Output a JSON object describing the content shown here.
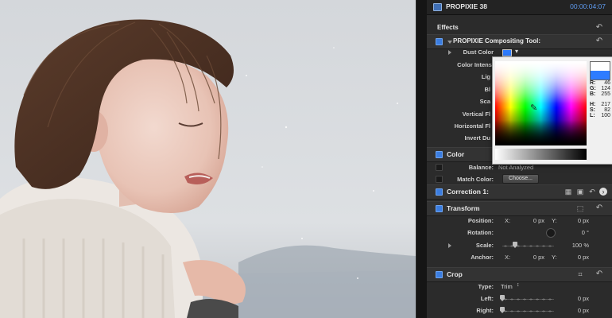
{
  "title": {
    "clip_name": "PROPIXIE 38",
    "timecode": "00:00:04:07"
  },
  "effects": {
    "label": "Effects",
    "tool_name": "PROPIXIE Compositing Tool:",
    "params": [
      {
        "label": "Dust Color"
      },
      {
        "label": "Color Intensi"
      },
      {
        "label": "Lig"
      },
      {
        "label": "Bl"
      },
      {
        "label": "Sca"
      },
      {
        "label": "Vertical Fl"
      },
      {
        "label": "Horizontal Fl"
      },
      {
        "label": "Invert Du"
      }
    ],
    "dust_color_hex": "#2e7cff"
  },
  "color_picker": {
    "r_label": "R:",
    "r_value": "46",
    "g_label": "G:",
    "g_value": "124",
    "b_label": "B:",
    "b_value": "255",
    "h_label": "H:",
    "h_value": "217",
    "s_label": "S:",
    "s_value": "82",
    "l_label": "L:",
    "l_value": "100"
  },
  "color": {
    "label": "Color",
    "balance_label": "Balance:",
    "balance_value": "Not Analyzed",
    "match_label": "Match Color:",
    "choose_button": "Choose...",
    "correction_label": "Correction 1:"
  },
  "transform": {
    "label": "Transform",
    "position_label": "Position:",
    "position_x_label": "X:",
    "position_x": "0 px",
    "position_y_label": "Y:",
    "position_y": "0 px",
    "rotation_label": "Rotation:",
    "rotation_value": "0 °",
    "scale_label": "Scale:",
    "scale_value": "100 %",
    "anchor_label": "Anchor:",
    "anchor_x_label": "X:",
    "anchor_x": "0 px",
    "anchor_y_label": "Y:",
    "anchor_y": "0 px"
  },
  "crop": {
    "label": "Crop",
    "type_label": "Type:",
    "type_value": "Trim",
    "left_label": "Left:",
    "left_value": "0 px",
    "right_label": "Right:",
    "right_value": "0 px"
  },
  "icons": {
    "reset": "reset-arrow-icon",
    "clip": "clip-icon",
    "disclosure": "disclosure-triangle-icon",
    "eyedropper": "eyedropper-icon"
  },
  "colors": {
    "accent": "#3b7de0",
    "timecode": "#5f9bf0",
    "panel_bg": "#2b2b2b"
  }
}
